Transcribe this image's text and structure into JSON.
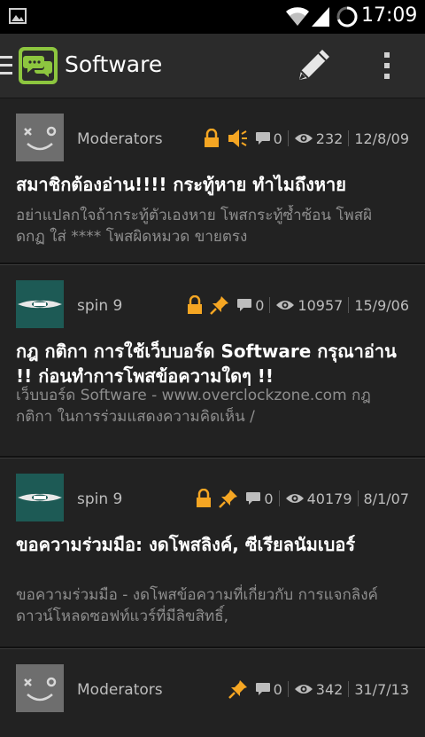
{
  "status_bar": {
    "time": "17:09"
  },
  "action_bar": {
    "title": "Software"
  },
  "threads": [
    {
      "author": "Moderators",
      "avatar": "moderator-avatar",
      "locked": true,
      "announcement": true,
      "pinned": false,
      "replies": "0",
      "views": "232",
      "date": "12/8/09",
      "title": "สมาชิกต้องอ่าน!!!!  กระทู้หาย ทำไมถึงหาย",
      "excerpt": "อย่าแปลกใจถ้ากระทู้ตัวเองหาย โพสกระทู้ซ้ำซ้อน โพสผิดกฏ ใส่ **** โพสผิดหมวด ขายตรง"
    },
    {
      "author": "spin 9",
      "avatar": "mini-works-avatar",
      "locked": true,
      "announcement": false,
      "pinned": true,
      "replies": "0",
      "views": "10957",
      "date": "15/9/06",
      "title": "กฎ กติกา การใช้เว็บบอร์ด Software กรุณาอ่าน !! ก่อนทำการโพสข้อความใดๆ !!",
      "excerpt": "เว็บบอร์ด Software - www.overclockzone.com กฎ กติกา ในการร่วมแสดงความคิดเห็น /"
    },
    {
      "author": "spin 9",
      "avatar": "mini-works-avatar",
      "locked": true,
      "announcement": false,
      "pinned": true,
      "replies": "0",
      "views": "40179",
      "date": "8/1/07",
      "title": "ขอความร่วมมือ: งดโพสลิงค์, ซีเรียลนัมเบอร์",
      "excerpt": "ขอความร่วมมือ - งดโพสข้อความที่เกี่ยวกับ การแจกลิงค์ดาวน์โหลดซอฟท์แวร์ที่มีลิขสิทธิ์,"
    },
    {
      "author": "Moderators",
      "avatar": "moderator-avatar",
      "locked": false,
      "announcement": false,
      "pinned": true,
      "replies": "0",
      "views": "342",
      "date": "31/7/13",
      "title": "",
      "excerpt": ""
    }
  ]
}
